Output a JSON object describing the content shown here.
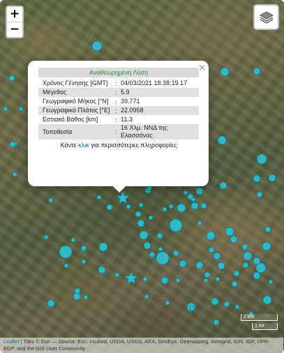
{
  "map": {
    "controls": {
      "zoom_in": "+",
      "zoom_out": "−"
    },
    "popup": {
      "close": "×",
      "header": "Αναθεωρημένη Λύση",
      "rows": [
        {
          "label": "Χρόνος Γένησης [GMT]",
          "sep": ":",
          "value": "04/03/2021 18:38:19.17"
        },
        {
          "label": "Μέγεθος",
          "sep": ":",
          "value": "5.9"
        },
        {
          "label": "Γεωγραφικό Μήκος [°N]",
          "sep": ":",
          "value": "39.771"
        },
        {
          "label": "Γεωγραφικό Πλάτος [°E]",
          "sep": ":",
          "value": "22.0958"
        },
        {
          "label": "Εστιακό Βάθος [km]",
          "sep": ":",
          "value": "11.3"
        },
        {
          "label": "Τοποθεσία",
          "sep": ":",
          "value": "16 Χλμ. ΝΝΔ της Ελασσόνας"
        }
      ],
      "footer_pre": "Κάντε",
      "footer_link": "κλικ",
      "footer_post": "για περισσότερες πληροφορίες"
    },
    "scale": {
      "km": "2 km",
      "mi": "1 mi"
    },
    "attribution": {
      "leaflet": "Leaflet",
      "text": "| Tiles © Esri — Source: Esri, i-cubed, USDA, USGS, AEX, GeoEye, Getmapping, Aerogrid, IGN, IGP, UPR-EGP, and the GIS User Community"
    },
    "colors": {
      "marker": "#2bbfd0",
      "marker_stroke": "#137a87",
      "header_text": "#2e8b3a"
    }
  }
}
